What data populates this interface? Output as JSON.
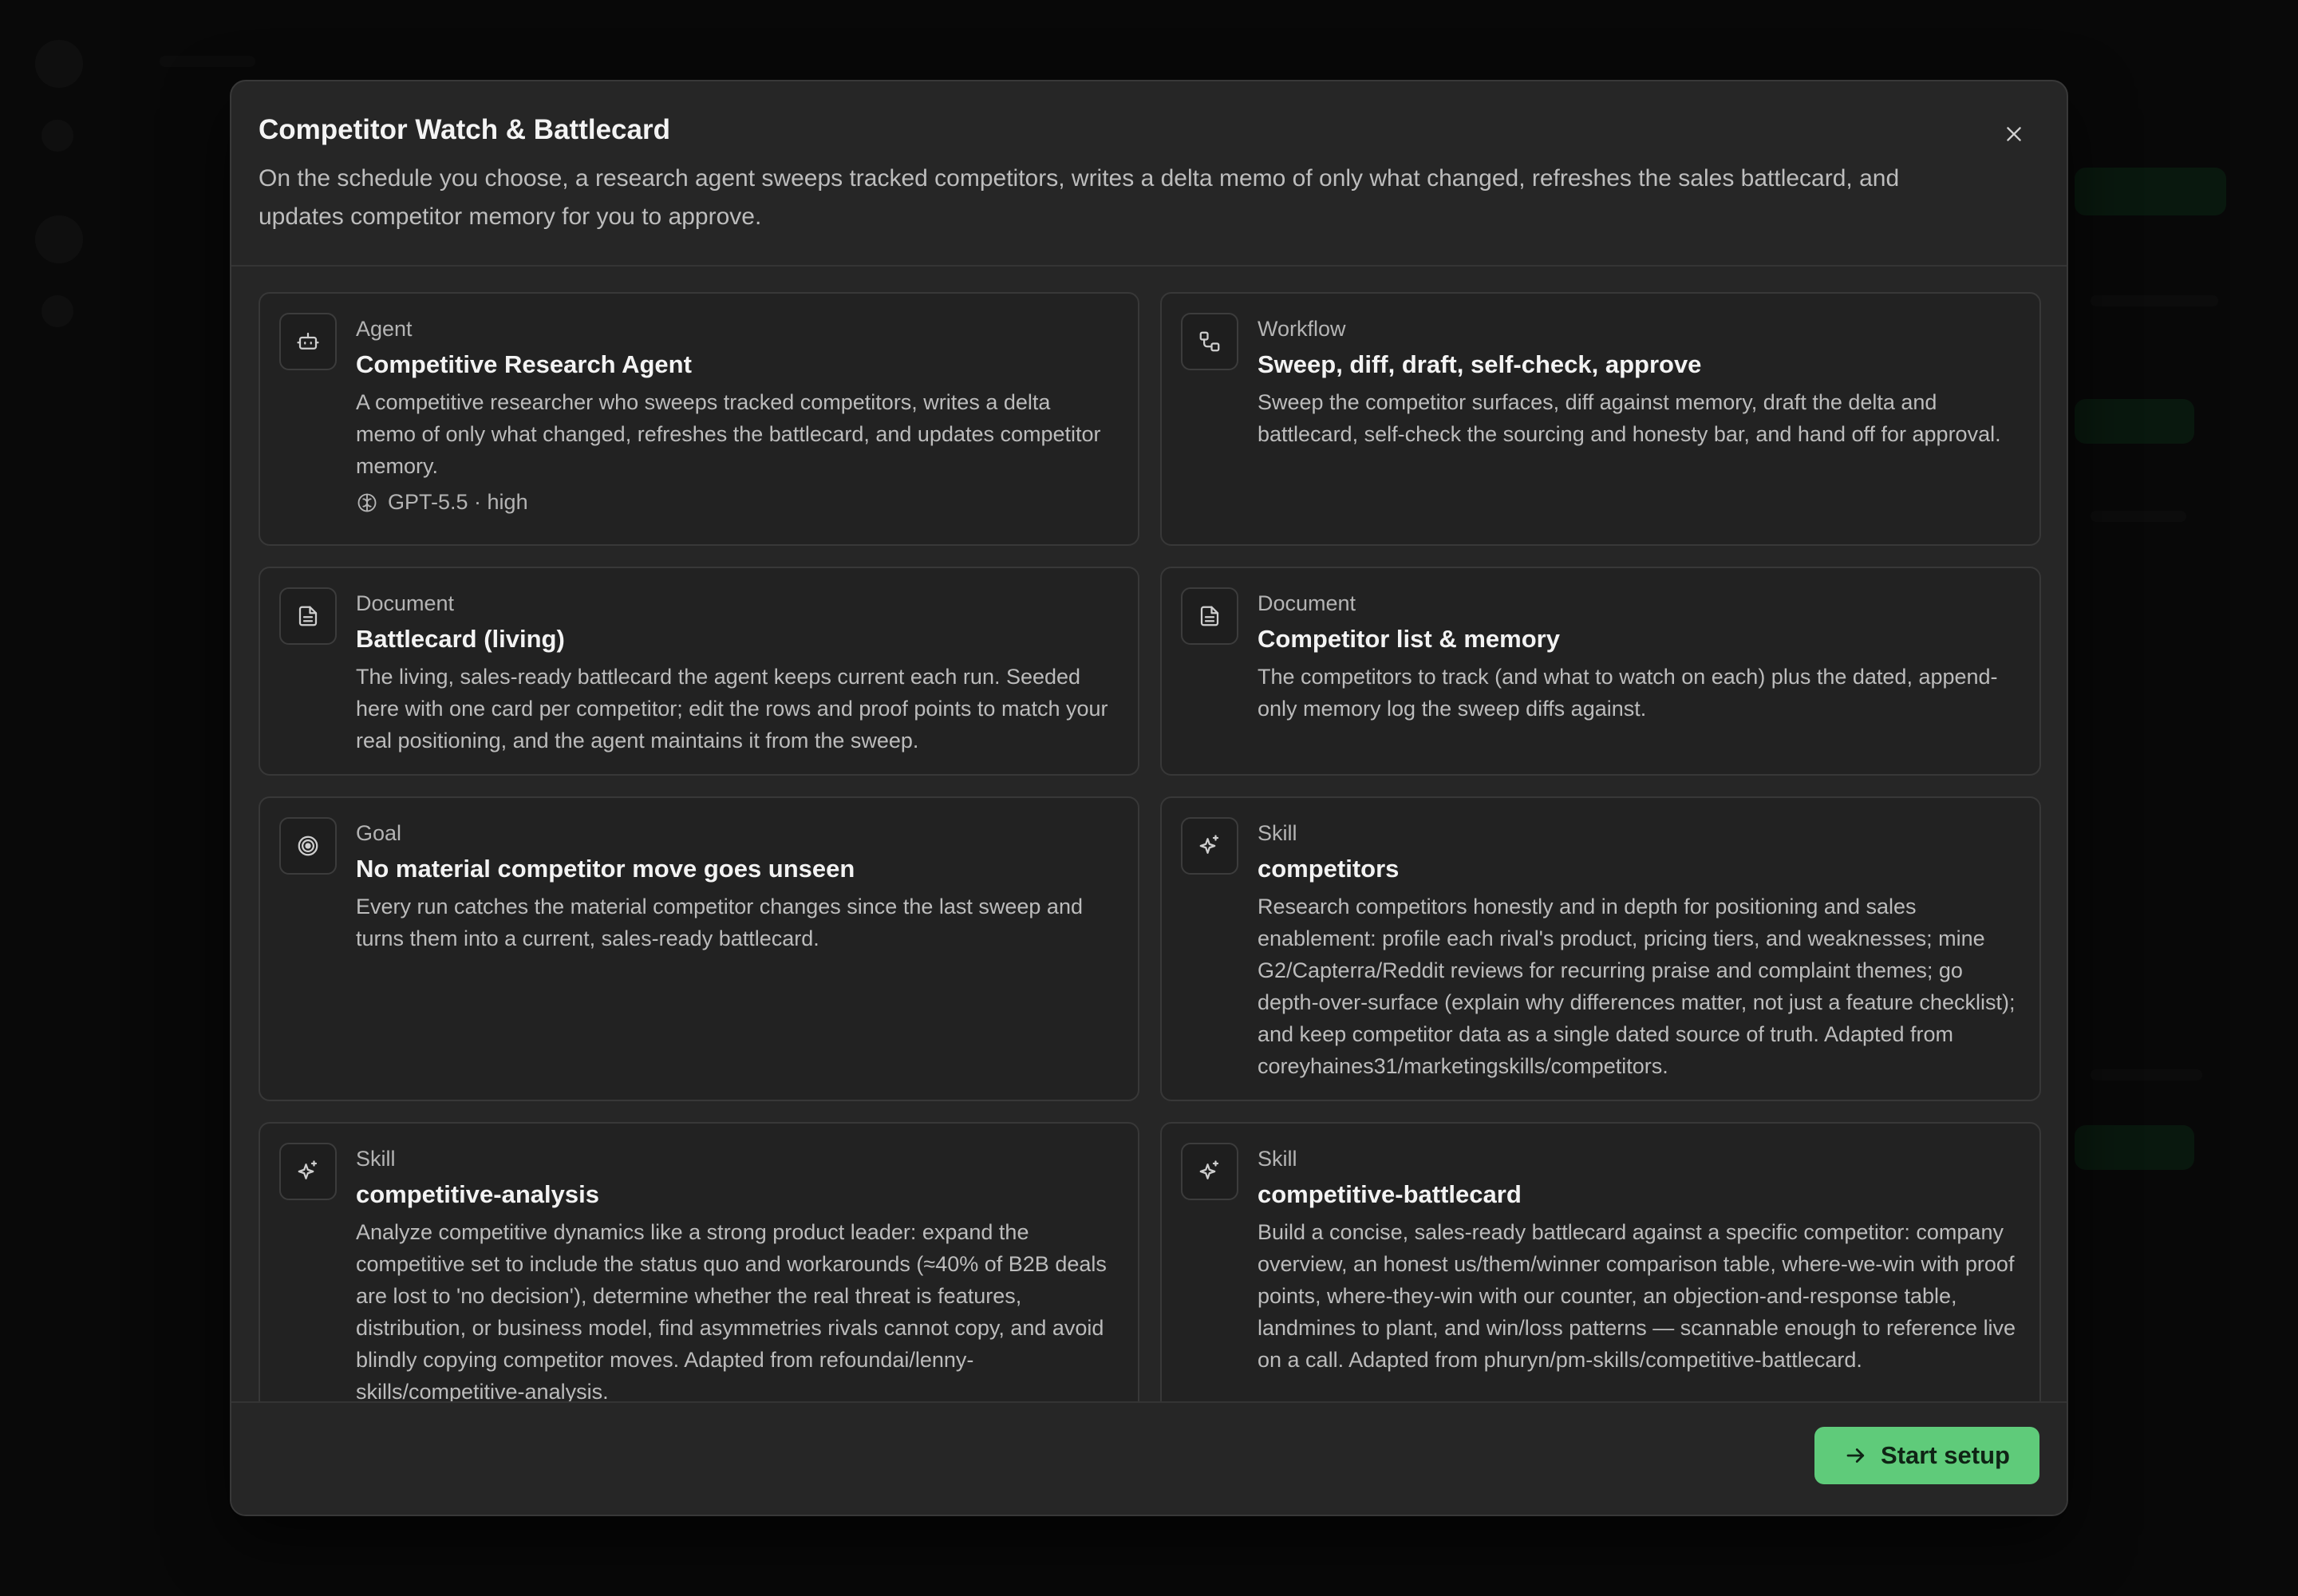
{
  "modal": {
    "title": "Competitor Watch & Battlecard",
    "description": "On the schedule you choose, a research agent sweeps tracked competitors, writes a delta memo of only what changed, refreshes the sales battlecard, and updates competitor memory for you to approve.",
    "close_icon": "close-icon"
  },
  "cards": [
    {
      "type": "Agent",
      "name": "Competitive Research Agent",
      "description": "A competitive researcher who sweeps tracked competitors, writes a delta memo of only what changed, refreshes the battlecard, and updates competitor memory.",
      "meta": "GPT-5.5 · high",
      "icon": "bot-icon"
    },
    {
      "type": "Workflow",
      "name": "Sweep, diff, draft, self-check, approve",
      "description": "Sweep the competitor surfaces, diff against memory, draft the delta and battlecard, self-check the sourcing and honesty bar, and hand off for approval.",
      "icon": "workflow-icon"
    },
    {
      "type": "Document",
      "name": "Battlecard (living)",
      "description": "The living, sales-ready battlecard the agent keeps current each run. Seeded here with one card per competitor; edit the rows and proof points to match your real positioning, and the agent maintains it from the sweep.",
      "icon": "document-icon"
    },
    {
      "type": "Document",
      "name": "Competitor list & memory",
      "description": "The competitors to track (and what to watch on each) plus the dated, append-only memory log the sweep diffs against.",
      "icon": "document-icon"
    },
    {
      "type": "Goal",
      "name": "No material competitor move goes unseen",
      "description": "Every run catches the material competitor changes since the last sweep and turns them into a current, sales-ready battlecard.",
      "icon": "target-icon"
    },
    {
      "type": "Skill",
      "name": "competitors",
      "description": "Research competitors honestly and in depth for positioning and sales enablement: profile each rival's product, pricing tiers, and weaknesses; mine G2/Capterra/Reddit reviews for recurring praise and complaint themes; go depth-over-surface (explain why differences matter, not just a feature checklist); and keep competitor data as a single dated source of truth. Adapted from coreyhaines31/marketingskills/competitors.",
      "icon": "sparkle-icon"
    },
    {
      "type": "Skill",
      "name": "competitive-analysis",
      "description": "Analyze competitive dynamics like a strong product leader: expand the competitive set to include the status quo and workarounds (≈40% of B2B deals are lost to 'no decision'), determine whether the real threat is features, distribution, or business model, find asymmetries rivals cannot copy, and avoid blindly copying competitor moves. Adapted from refoundai/lenny-skills/competitive-analysis.",
      "icon": "sparkle-icon"
    },
    {
      "type": "Skill",
      "name": "competitive-battlecard",
      "description": "Build a concise, sales-ready battlecard against a specific competitor: company overview, an honest us/them/winner comparison table, where-we-win with proof points, where-they-win with our counter, an objection-and-response table, landmines to plant, and win/loss patterns — scannable enough to reference live on a call. Adapted from phuryn/pm-skills/competitive-battlecard.",
      "icon": "sparkle-icon"
    }
  ],
  "footer": {
    "start_label": "Start setup",
    "start_icon": "arrow-right-icon"
  },
  "colors": {
    "accent": "#5fcb7a",
    "modal_bg": "#262626",
    "card_bg": "#222222"
  }
}
